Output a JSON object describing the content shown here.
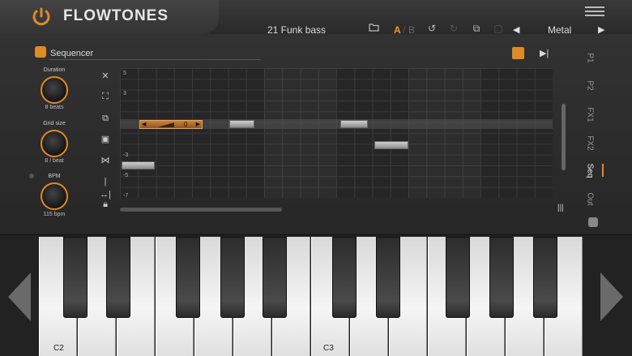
{
  "app": {
    "title": "FLOWTONES"
  },
  "header": {
    "preset_name": "21 Funk bass",
    "ab_a": "A",
    "ab_sep": "/",
    "ab_b": "B",
    "category": "Metal"
  },
  "sequencer": {
    "title": "Sequencer",
    "knobs": [
      {
        "label": "Duration",
        "value": "8 beats"
      },
      {
        "label": "Grid size",
        "value": "8 / beat"
      },
      {
        "label": "BPM",
        "value": "115 bpm"
      }
    ],
    "y_ticks": [
      "5",
      "3",
      "-3",
      "-5",
      "-7"
    ],
    "selected_note_value": "0"
  },
  "side_tabs": [
    "P1",
    "P2",
    "FX1",
    "FX2",
    "Seq",
    "Out"
  ],
  "active_tab": "Seq",
  "keyboard": {
    "labels": [
      "C2",
      "C3"
    ]
  },
  "colors": {
    "accent": "#e08a25"
  }
}
